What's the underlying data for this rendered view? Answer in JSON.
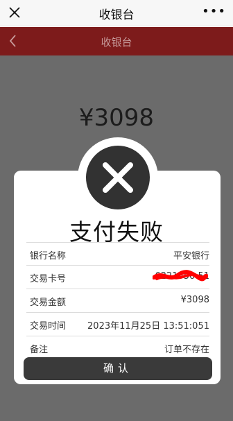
{
  "wechat": {
    "title": "收银台",
    "more": "•••"
  },
  "header": {
    "title": "收银台"
  },
  "payment": {
    "amount": "¥3098"
  },
  "dialog": {
    "title": "支付失败",
    "rows": [
      {
        "label": "银行名称",
        "value": "平安银行"
      },
      {
        "label": "交易卡号",
        "value": "6221550         51"
      },
      {
        "label": "交易金额",
        "value": "¥3098"
      },
      {
        "label": "交易时间",
        "value": "2023年11月25日 13:51:051"
      },
      {
        "label": "备注",
        "value": "订单不存在"
      }
    ],
    "confirm_label": "确认"
  },
  "icons": {
    "close": "close-icon",
    "back": "chevron-left-icon",
    "fail": "x-circle-icon",
    "more": "more-icon"
  },
  "colors": {
    "header_bg": "#7d1b1b",
    "overlay_bg": "#6b6b6b",
    "button_bg": "#3a3a3a",
    "redaction": "#ff0000"
  }
}
